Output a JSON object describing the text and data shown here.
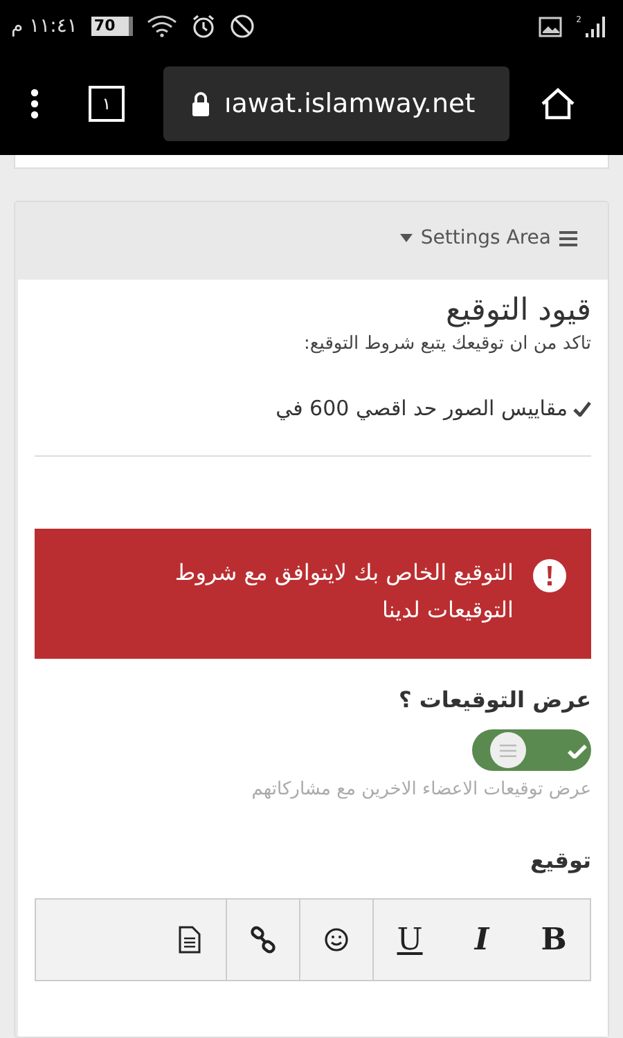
{
  "status_bar": {
    "time": "١١:٤١ م",
    "battery": "70",
    "sim": "2"
  },
  "browser": {
    "url": "ıawat.islamway.net",
    "tab_count": "١"
  },
  "panel": {
    "header": "Settings Area"
  },
  "restrictions": {
    "title": "قيود التوقيع",
    "subtitle": "تاكد من ان توقيعك يتبع شروط التوقيع:",
    "rules": [
      {
        "text": "مقاييس الصور حد اقصي 600 في"
      }
    ]
  },
  "alert": {
    "message": "التوقيع الخاص بك لايتوافق مع شروط التوقيعات لدينا"
  },
  "show_signatures": {
    "label": "عرض التوقيعات ؟",
    "on": true,
    "hint": "عرض توقيعات الاعضاء الاخرين مع مشاركاتهم"
  },
  "signature": {
    "label": "توقيع",
    "toolbar": [
      {
        "kind": "bold",
        "label": "B"
      },
      {
        "kind": "italic",
        "label": "I"
      },
      {
        "kind": "underline",
        "label": "U"
      },
      {
        "kind": "smiley"
      },
      {
        "kind": "link"
      },
      {
        "kind": "document"
      }
    ]
  }
}
